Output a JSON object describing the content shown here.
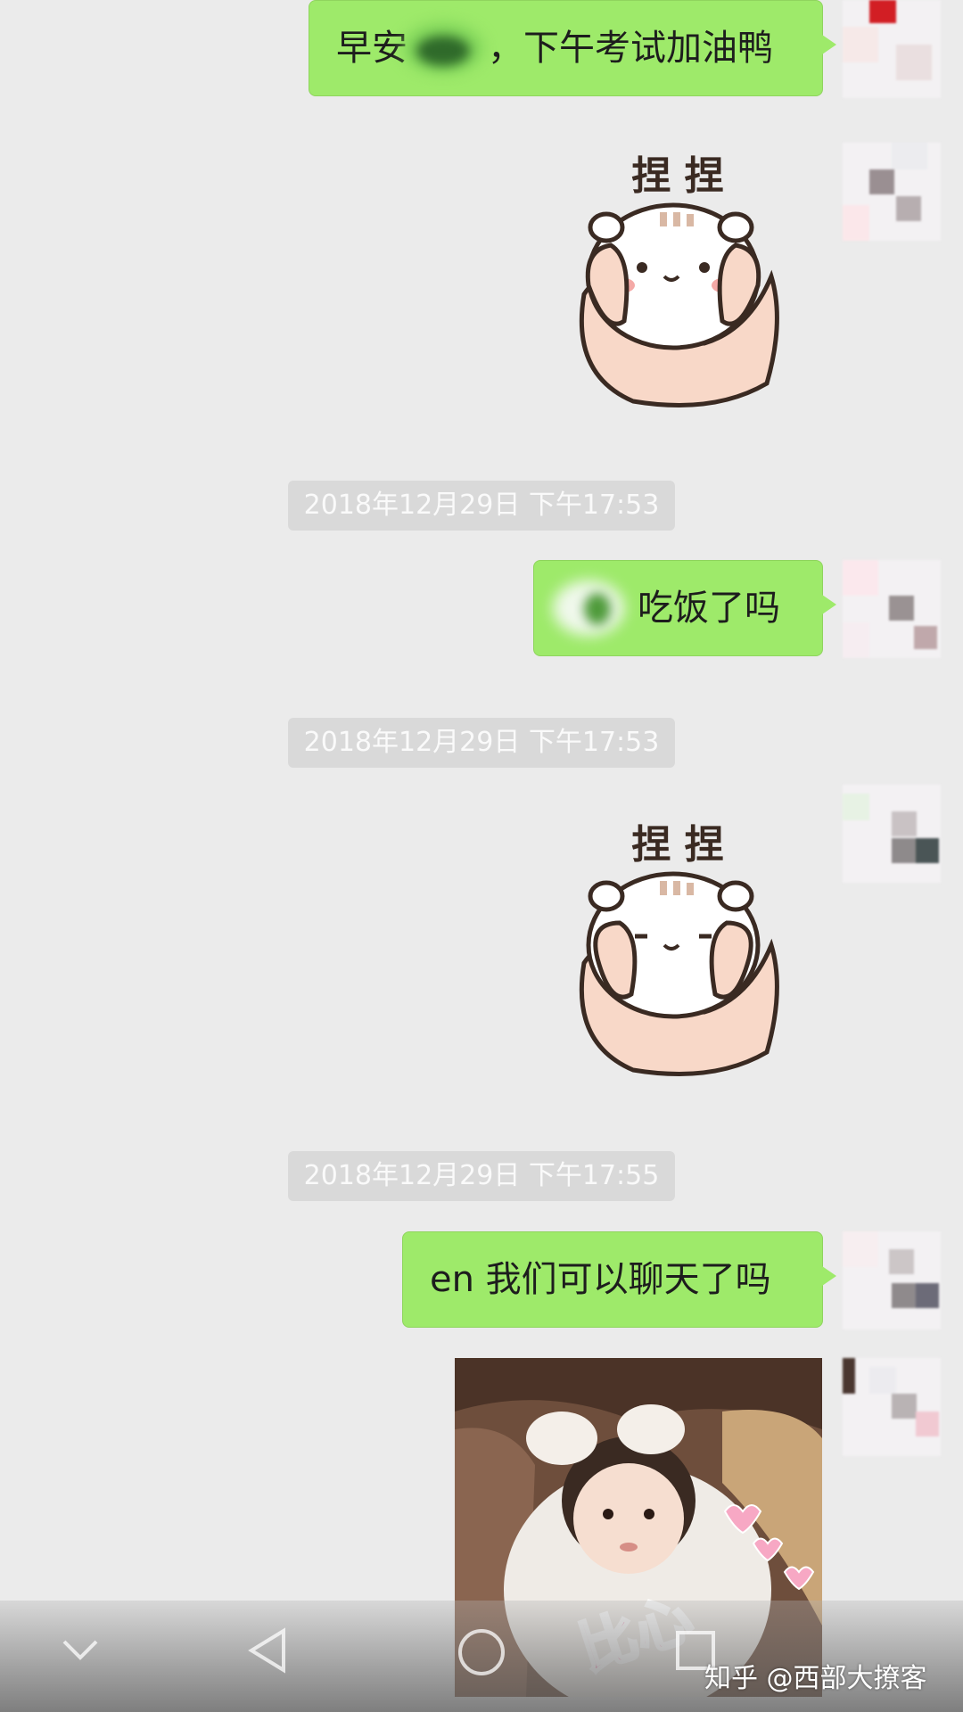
{
  "messages": {
    "m1": "早安",
    "m1b": "，下午考试加油鸭",
    "m2": "吃饭了吗",
    "m3": "en 我们可以聊天了吗"
  },
  "timestamps": {
    "t1": "2018年12月29日 下午17:53",
    "t2": "2018年12月29日 下午17:53",
    "t3": "2018年12月29日 下午17:55"
  },
  "stickers": {
    "s1_caption": "捏 捏",
    "s2_caption": "捏 捏"
  },
  "photo": {
    "caption": "比心"
  },
  "navbar": {
    "back_icon": "back-triangle-icon",
    "home_icon": "home-circle-icon",
    "recents_icon": "recents-square-icon",
    "collapse_icon": "chevron-down-icon"
  },
  "watermark": "知乎 @西部大撩客",
  "colors": {
    "background": "#ebebeb",
    "bubble": "#9eea6a",
    "timestamp_bg": "#d9d9d9"
  }
}
